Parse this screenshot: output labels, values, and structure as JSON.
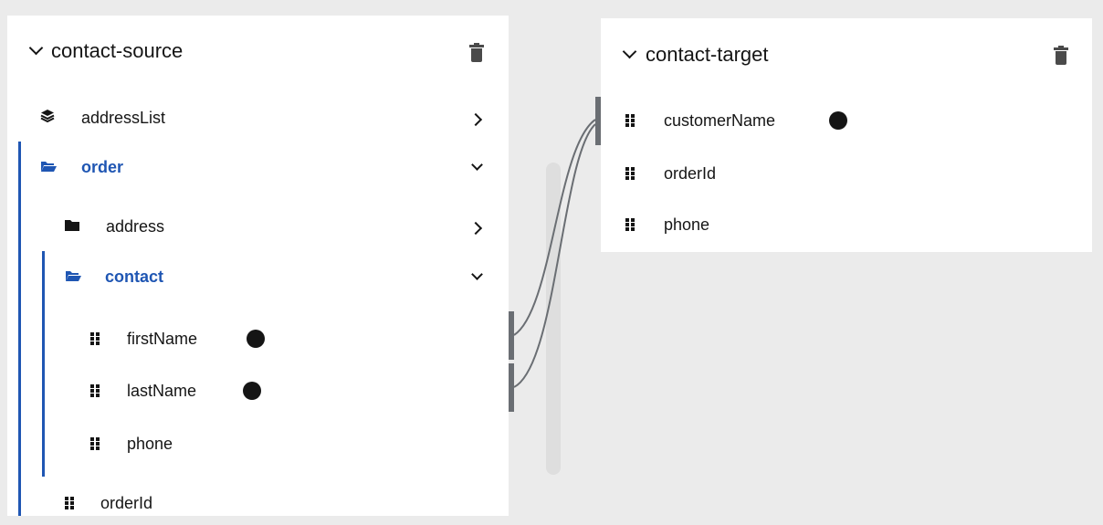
{
  "source": {
    "title": "contact-source",
    "items": [
      {
        "label": "addressList"
      },
      {
        "label": "order"
      },
      {
        "label": "address"
      },
      {
        "label": "contact"
      },
      {
        "label": "firstName"
      },
      {
        "label": "lastName"
      },
      {
        "label": "phone"
      },
      {
        "label": "orderId"
      }
    ]
  },
  "target": {
    "title": "contact-target",
    "items": [
      {
        "label": "customerName"
      },
      {
        "label": "orderId"
      },
      {
        "label": "phone"
      }
    ]
  },
  "mappings": [
    {
      "from": "order.contact.firstName",
      "to": "customerName"
    },
    {
      "from": "order.contact.lastName",
      "to": "customerName"
    }
  ],
  "colors": {
    "accent": "#1f56b3",
    "connector": "#6a6e73",
    "background": "#ebebeb"
  }
}
